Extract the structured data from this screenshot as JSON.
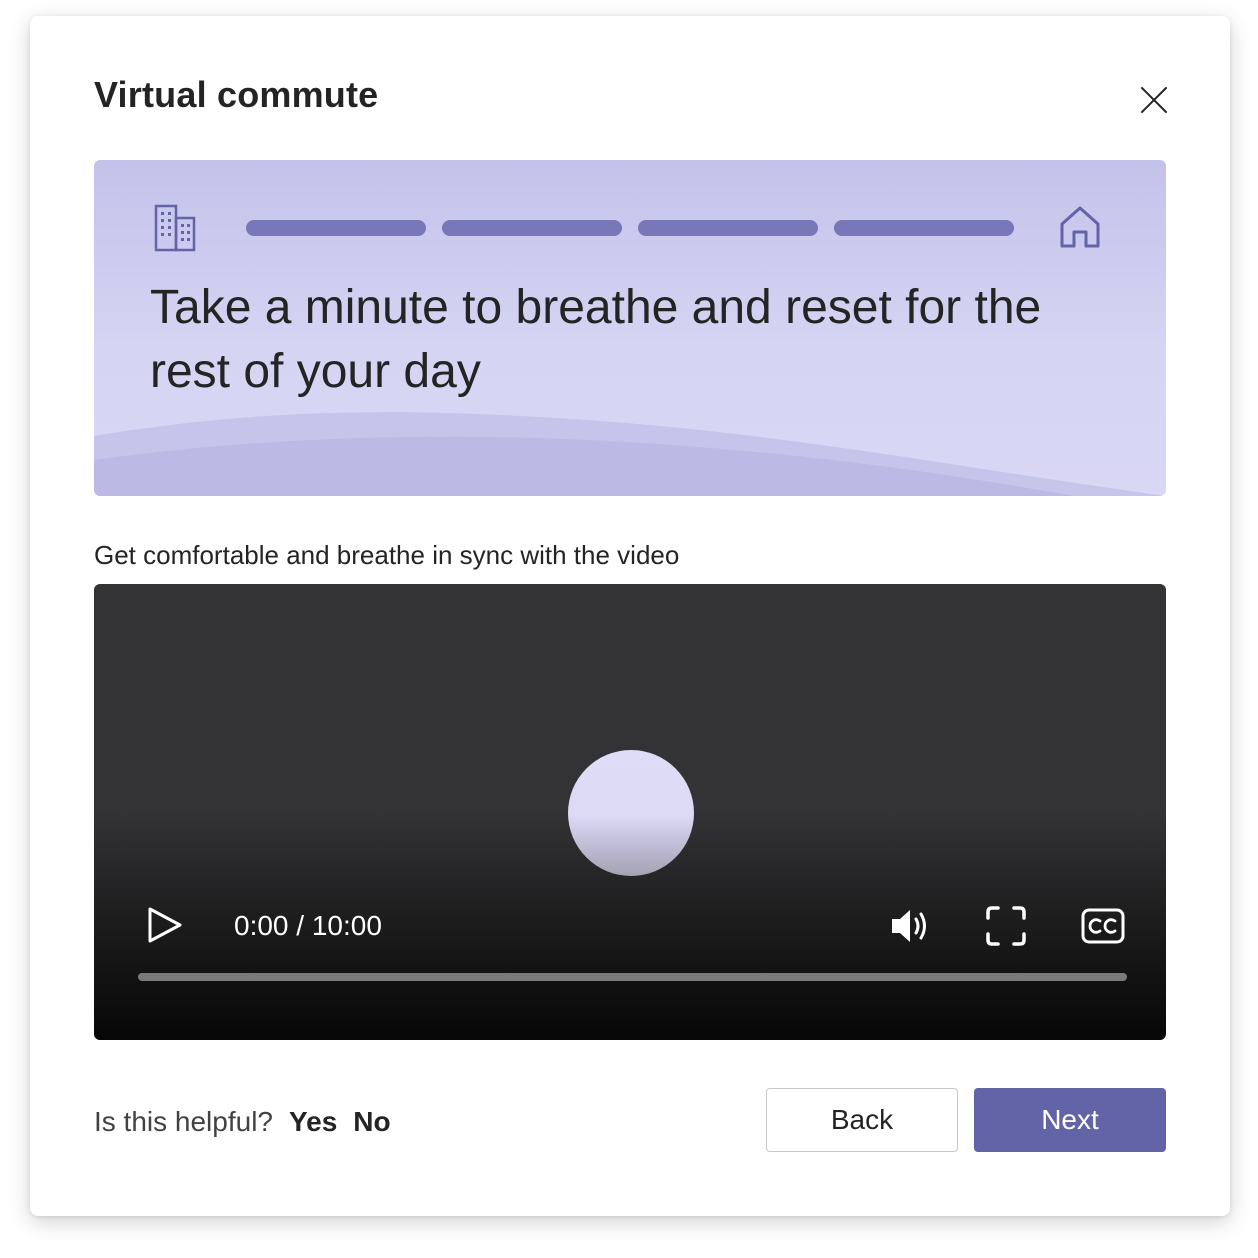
{
  "dialog": {
    "title": "Virtual commute",
    "close_icon": "close-icon"
  },
  "banner": {
    "start_icon": "office-building-icon",
    "end_icon": "home-icon",
    "progress_steps_total": 4,
    "progress_steps_completed": 4,
    "text": "Take a minute to breathe and reset for the rest of your day"
  },
  "video_section": {
    "instruction": "Get comfortable and breathe in sync with the video",
    "player": {
      "play_icon": "play-icon",
      "time_display": "0:00 / 10:00",
      "volume_icon": "volume-icon",
      "fullscreen_icon": "fullscreen-icon",
      "captions_icon": "closed-captions-icon",
      "progress": 0
    }
  },
  "footer": {
    "helpful_prompt": "Is this helpful?",
    "yes_label": "Yes",
    "no_label": "No",
    "back_label": "Back",
    "next_label": "Next"
  },
  "colors": {
    "accent": "#6264a7",
    "progress_segment": "#7877b7",
    "banner_bg": "#c3c2ea",
    "video_bg": "#333336"
  }
}
